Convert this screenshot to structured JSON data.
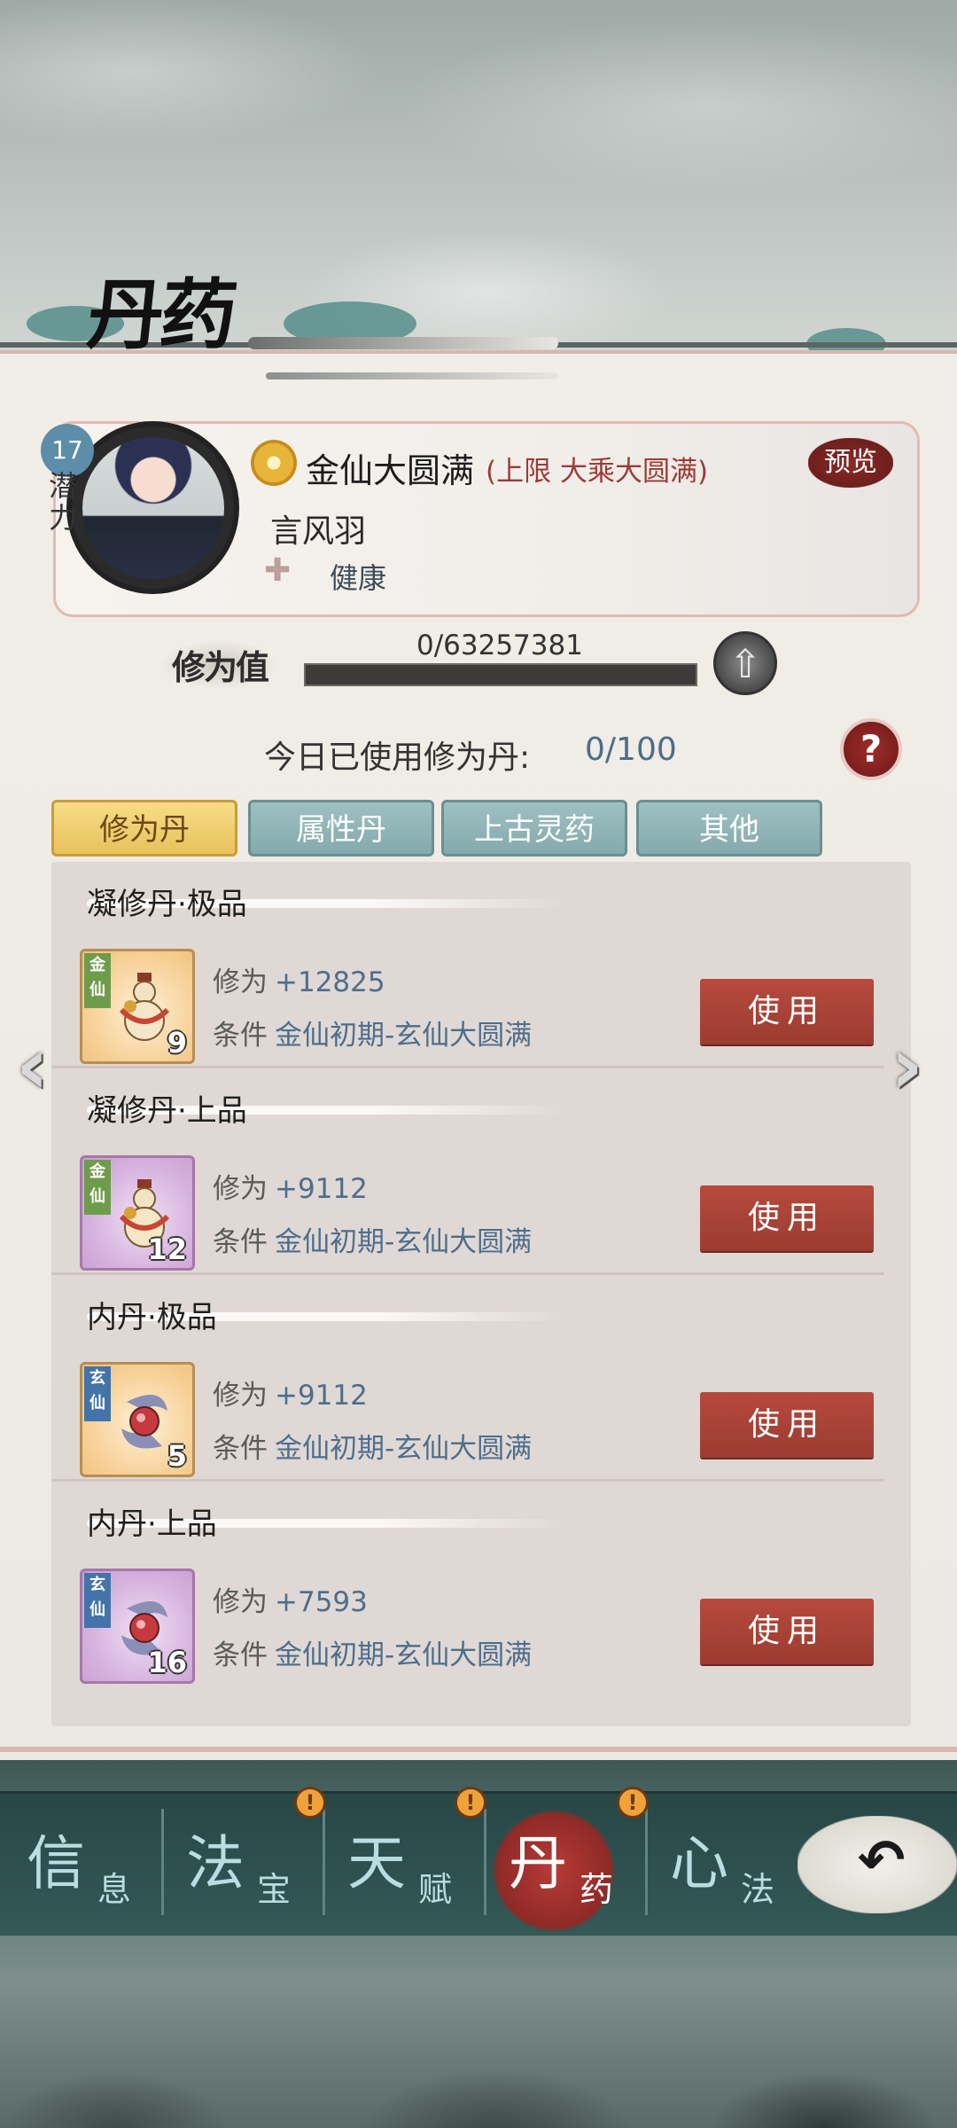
{
  "page": {
    "title": "丹药"
  },
  "profile": {
    "potential_level": "17",
    "potential_label": "潜力",
    "realm": "金仙大圆满",
    "realm_limit": "(上限 大乘大圆满)",
    "preview_label": "预览",
    "name": "言风羽",
    "status": "健康"
  },
  "cultivation": {
    "label": "修为值",
    "value_text": "0/63257381",
    "current": 0,
    "max": 63257381
  },
  "daily": {
    "label": "今日已使用修为丹:",
    "value": "0/100",
    "help": "?"
  },
  "tabs": [
    {
      "label": "修为丹",
      "active": true
    },
    {
      "label": "属性丹",
      "active": false
    },
    {
      "label": "上古灵药",
      "active": false
    },
    {
      "label": "其他",
      "active": false
    }
  ],
  "items": [
    {
      "title": "凝修丹·极品",
      "realm_tag": "金仙",
      "count": "9",
      "attr1_key": "修为",
      "attr1_val": "+12825",
      "attr2_key": "条件",
      "attr2_val": "金仙初期-玄仙大圆满",
      "use_label": "使用"
    },
    {
      "title": "凝修丹·上品",
      "realm_tag": "金仙",
      "count": "12",
      "attr1_key": "修为",
      "attr1_val": "+9112",
      "attr2_key": "条件",
      "attr2_val": "金仙初期-玄仙大圆满",
      "use_label": "使用"
    },
    {
      "title": "内丹·极品",
      "realm_tag": "玄仙",
      "count": "5",
      "attr1_key": "修为",
      "attr1_val": "+9112",
      "attr2_key": "条件",
      "attr2_val": "金仙初期-玄仙大圆满",
      "use_label": "使用"
    },
    {
      "title": "内丹·上品",
      "realm_tag": "玄仙",
      "count": "16",
      "attr1_key": "修为",
      "attr1_val": "+7593",
      "attr2_key": "条件",
      "attr2_val": "金仙初期-玄仙大圆满",
      "use_label": "使用"
    }
  ],
  "bottom_nav": [
    {
      "big": "信",
      "small": "息",
      "alert": false,
      "active": false
    },
    {
      "big": "法",
      "small": "宝",
      "alert": true,
      "active": false
    },
    {
      "big": "天",
      "small": "赋",
      "alert": true,
      "active": false
    },
    {
      "big": "丹",
      "small": "药",
      "alert": true,
      "active": true
    },
    {
      "big": "心",
      "small": "法",
      "alert": false,
      "active": false
    }
  ],
  "alert_symbol": "!",
  "colors": {
    "accent_red": "#9c3b31",
    "tab_active": "#e8c25b",
    "tab_inactive": "#84aaad",
    "value_blue": "#4d6e8c"
  },
  "icons": {
    "prev": "chevron-left-icon",
    "next": "chevron-right-icon",
    "up": "arrow-up-icon",
    "back": "back-arrow-icon",
    "heart": "heart-icon",
    "realm": "realm-emblem-icon"
  }
}
